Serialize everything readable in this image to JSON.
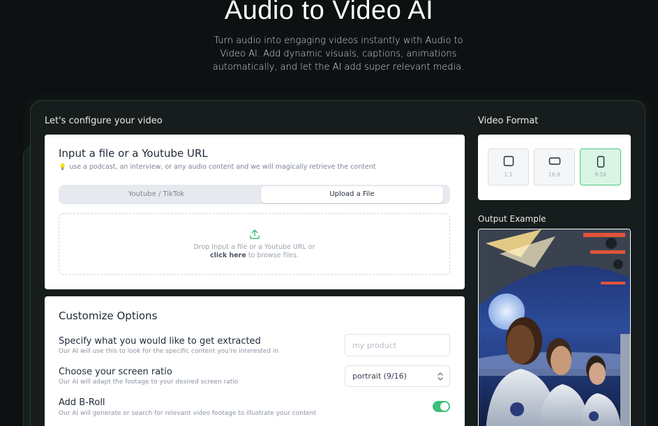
{
  "hero": {
    "title": "Audio to Video AI",
    "subtitle": "Turn audio into engaging videos instantly with Audio to Video AI. Add dynamic visuals, captions, animations automatically, and let the AI add super relevant media."
  },
  "config": {
    "section_label": "Let's configure your video",
    "input_panel": {
      "title": "Input a file or a Youtube URL",
      "hint_icon": "lightbulb-icon",
      "hint": "use a podcast, an interview, or any audio content and we will magically retrieve the content",
      "tabs": [
        {
          "label": "Youtube / TikTok",
          "active": false
        },
        {
          "label": "Upload a File",
          "active": true
        }
      ],
      "dropzone": {
        "icon": "upload-icon",
        "line1": "Drop Input a file or a Youtube URL or",
        "link": "click here",
        "line2_rest": " to browse files."
      }
    },
    "options_panel": {
      "title": "Customize Options",
      "extract": {
        "title": "Specify what you would like to get extracted",
        "desc": "Our AI will use this to look for the specific content you're interested in",
        "placeholder": "my product",
        "value": ""
      },
      "ratio": {
        "title": "Choose your screen ratio",
        "desc": "Our AI will adapt the footage to your desired screen ratio",
        "selected": "portrait (9/16)"
      },
      "broll": {
        "title": "Add B-Roll",
        "desc": "Our AI will generate or search for relevant video footage to illustrate your content",
        "enabled": true
      }
    }
  },
  "format": {
    "section_label": "Video Format",
    "options": [
      {
        "label": "1:1",
        "active": false
      },
      {
        "label": "16:9",
        "active": false
      },
      {
        "label": "9:16",
        "active": true
      }
    ],
    "accent": "#4cc382"
  },
  "example": {
    "section_label": "Output Example"
  },
  "colors": {
    "background": "#0e1112",
    "card": "#161d1c",
    "toggle_on": "#3fbf78"
  }
}
